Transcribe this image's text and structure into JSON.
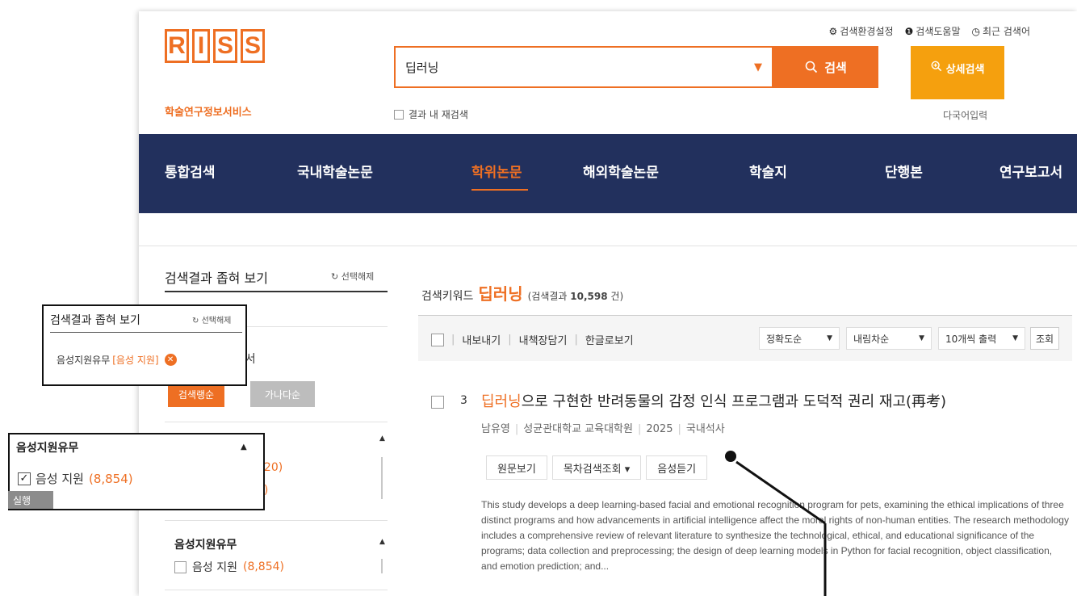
{
  "logo": {
    "letters": [
      "R",
      "I",
      "S",
      "S"
    ],
    "tagline": "학술연구정보서비스"
  },
  "top_links": [
    {
      "icon": "gear-icon",
      "glyph": "⚙",
      "label": "검색환경설정"
    },
    {
      "icon": "help-icon",
      "glyph": "❶",
      "label": "검색도움말"
    },
    {
      "icon": "clock-icon",
      "glyph": "◷",
      "label": "최근 검색어"
    }
  ],
  "search": {
    "value": "딥러닝",
    "button_label": "검색",
    "advanced_label": "상세검색",
    "research_within_label": "결과 내 재검색",
    "multilang_label": "다국어입력"
  },
  "nav": {
    "items": [
      "통합검색",
      "국내학술논문",
      "학위논문",
      "해외학술논문",
      "학술지",
      "단행본",
      "연구보고서"
    ],
    "active": "학위논문"
  },
  "left_panel": {
    "title": "검색결과 좁혀 보기",
    "reset_label": "선택해제",
    "sort_fragment": "기순서",
    "sort_buttons": [
      "검색랭순",
      "가나다순"
    ],
    "fragment_1": "120)",
    "fragment_2": "3)",
    "audio_filter": {
      "title": "음성지원유무",
      "option": "음성 지원",
      "count": "(8,854)"
    }
  },
  "results": {
    "keyword_label": "검색키워드",
    "keyword": "딥러닝",
    "count_prefix": "(검색결과",
    "count_value": "10,598",
    "count_suffix": "건)",
    "toolbar": {
      "actions": [
        "내보내기",
        "내책장담기",
        "한글로보기"
      ],
      "sort1": "정확도순",
      "sort2": "내림차순",
      "per_page": "10개씩 출력",
      "go_label": "조회"
    },
    "items": [
      {
        "number": "3",
        "title_highlight": "딥러닝",
        "title_rest": "으로 구현한 반려동물의 감정 인식 프로그램과 도덕적 권리 재고(再考)",
        "author": "남유영",
        "institution": "성균관대학교 교육대학원",
        "year": "2025",
        "type": "국내석사",
        "buttons": [
          "원문보기",
          "목차검색조회 ▾",
          "음성듣기"
        ],
        "abstract": "This study develops a deep learning-based facial and emotional recognition program for pets, examining the ethical implications of three distinct programs and how advancements in artificial intelligence affect the moral rights of non-human entities. The research methodology includes a comprehensive review of relevant literature to synthesize the technological, ethical, and educational significance of the programs; data collection and preprocessing; the design of deep learning models in Python for facial recognition, object classification, and emotion prediction; and..."
      }
    ]
  },
  "overlay_filter": {
    "title": "검색결과 좁혀 보기",
    "reset_label": "선택해제",
    "selected_label": "음성지원유무",
    "selected_value": "[음성 지원]"
  },
  "overlay_audio": {
    "title": "음성지원유무",
    "option": "음성 지원",
    "count": "(8,854)",
    "run_label": "실행"
  },
  "colors": {
    "accent": "#ee6f23",
    "accent_yellow": "#f5a00e",
    "nav_bg": "#22305d"
  }
}
